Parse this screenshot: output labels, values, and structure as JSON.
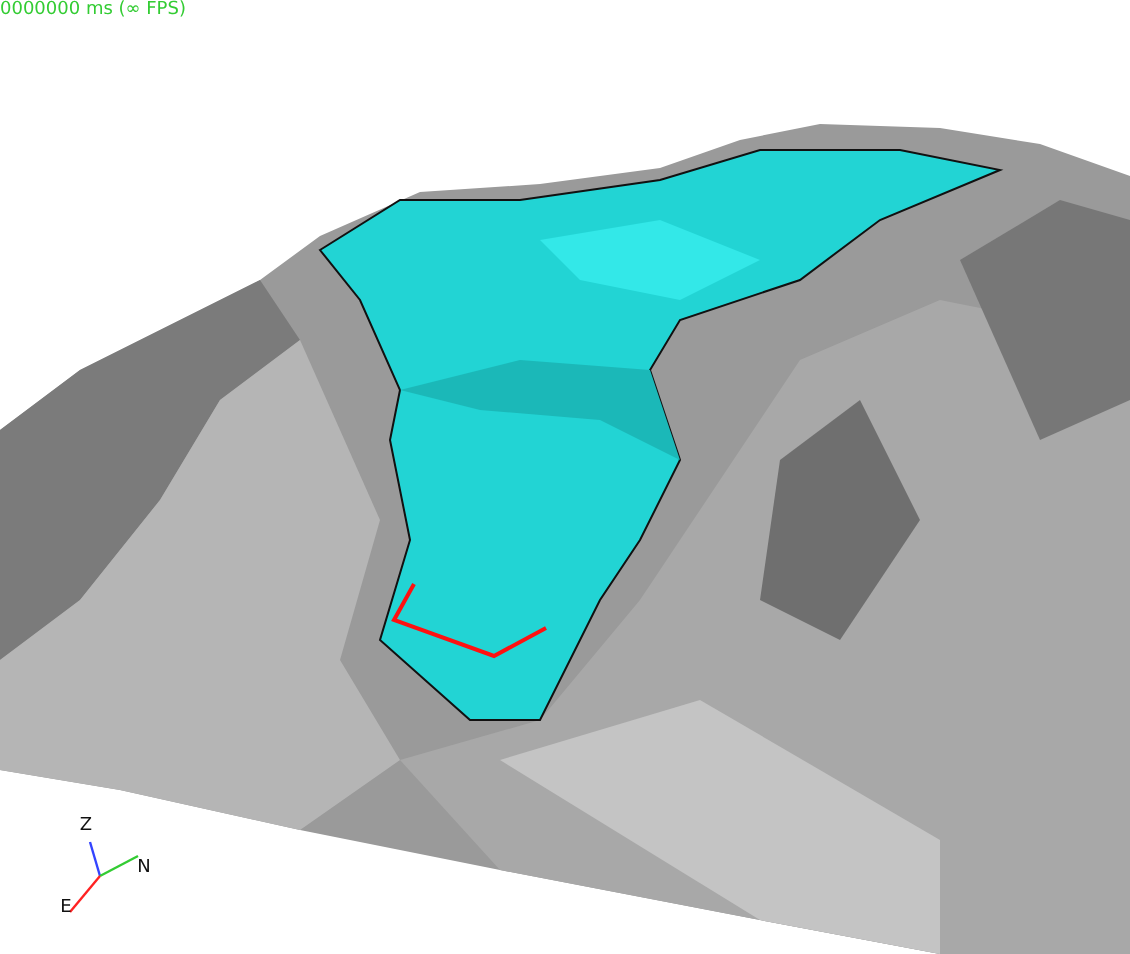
{
  "status": {
    "frame_time": "0000000 ms (∞ FPS)"
  },
  "axes": [
    {
      "kind": "z",
      "label": "Z"
    },
    {
      "kind": "n",
      "label": "N"
    },
    {
      "kind": "e",
      "label": "E"
    }
  ]
}
